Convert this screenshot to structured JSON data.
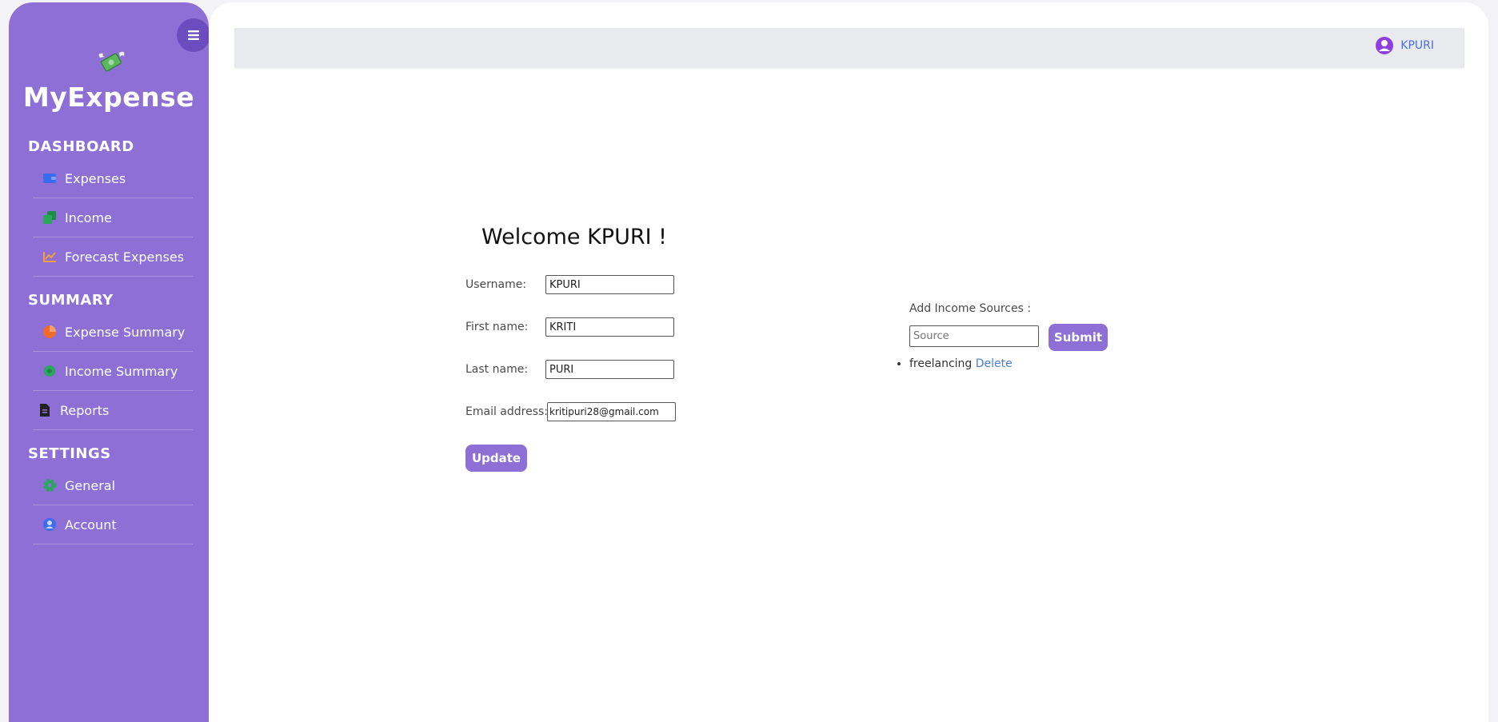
{
  "brand": {
    "name": "MyExpense",
    "logo_icon": "money-wings-icon"
  },
  "sidebar": {
    "sections": [
      {
        "title": "DASHBOARD",
        "items": [
          {
            "label": "Expenses",
            "icon": "wallet-icon",
            "color": "#3b6cf0"
          },
          {
            "label": "Income",
            "icon": "money-icon",
            "color": "#27a85a"
          },
          {
            "label": "Forecast Expenses",
            "icon": "chart-line-icon",
            "color": "#f0a040"
          }
        ]
      },
      {
        "title": "SUMMARY",
        "items": [
          {
            "label": "Expense Summary",
            "icon": "pie-chart-icon",
            "color": "#f06a2a"
          },
          {
            "label": "Income Summary",
            "icon": "circle-chart-icon",
            "color": "#27a85a"
          },
          {
            "label": "Reports",
            "icon": "file-report-icon",
            "color": "#222222"
          }
        ]
      },
      {
        "title": "SETTINGS",
        "items": [
          {
            "label": "General",
            "icon": "gear-icon",
            "color": "#27a85a"
          },
          {
            "label": "Account",
            "icon": "user-circle-icon",
            "color": "#3b6cf0"
          }
        ]
      }
    ]
  },
  "topbar": {
    "username": "KPURI"
  },
  "profile": {
    "welcome": "Welcome KPURI !",
    "fields": {
      "username": {
        "label": "Username:",
        "value": "KPURI"
      },
      "first_name": {
        "label": "First name:",
        "value": "KRITI"
      },
      "last_name": {
        "label": "Last name:",
        "value": "PURI"
      },
      "email": {
        "label": "Email address:",
        "value": "kritipuri28@gmail.com"
      }
    },
    "update_label": "Update"
  },
  "income_sources": {
    "label": "Add Income Sources :",
    "placeholder": "Source",
    "submit_label": "Submit",
    "items": [
      {
        "name": "freelancing",
        "delete_label": "Delete"
      }
    ]
  },
  "colors": {
    "sidebar": "#8d6fd5",
    "accent": "#8d6fd5",
    "link": "#4a7fd6",
    "topbar": "#e8eaed"
  }
}
